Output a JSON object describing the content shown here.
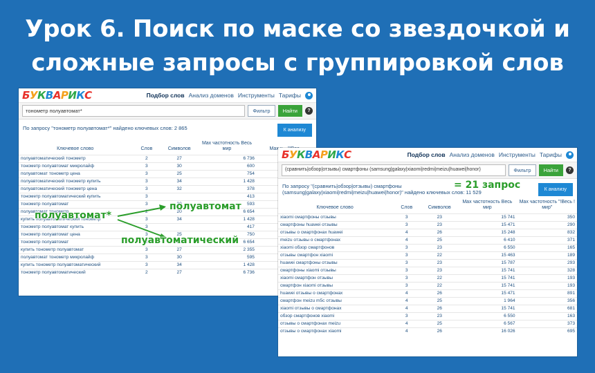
{
  "title_line1": "Урок 6. Поиск по маске со звездочкой и",
  "title_line2": "сложные запросы с группировкой слов",
  "logo": {
    "text": "БУКВАРИКС",
    "letters": [
      "Б",
      "У",
      "К",
      "В",
      "А",
      "Р",
      "И",
      "К",
      "С"
    ],
    "colors": [
      "#e8302a",
      "#f4a11d",
      "#2ea84a",
      "#1e88d4",
      "#e8302a",
      "#f4a11d",
      "#2ea84a",
      "#1e88d4",
      "#e8302a"
    ]
  },
  "nav": [
    "Подбор слов",
    "Анализ доменов",
    "Инструменты",
    "Тарифы"
  ],
  "filter_label": "Фильтр",
  "find_label": "Найти",
  "help_label": "?",
  "analyze_label": "К анализу",
  "screen1": {
    "query": "тонометр полуавтомат*",
    "result": "По запросу \"тонометр полуавтомат*\" найдено ключевых слов: 2 865",
    "headers": [
      "Ключевое слово",
      "Слов",
      "Символов",
      "Max частотность Весь мир",
      "Max ч... \"IBес..."
    ],
    "rows": [
      [
        "полуавтоматический тонометр",
        "2",
        "27",
        "6 736",
        ""
      ],
      [
        "тонометр полуавтомат микролайф",
        "3",
        "30",
        "600",
        ""
      ],
      [
        "полуавтомат тонометр цена",
        "3",
        "25",
        "754",
        ""
      ],
      [
        "полуавтоматический тонометр купить",
        "3",
        "34",
        "1 428",
        ""
      ],
      [
        "полуавтоматический тонометр цена",
        "3",
        "32",
        "378",
        ""
      ],
      [
        "тонометр полуавтоматический купить",
        "3",
        "",
        "413",
        ""
      ],
      [
        "тонометр полуавтомат",
        "3",
        "30",
        "593",
        ""
      ],
      [
        "полуавтомат тонометр",
        "2",
        "20",
        "6 654",
        ""
      ],
      [
        "купить полуавтоматический тонометр",
        "3",
        "34",
        "1 428",
        ""
      ],
      [
        "тонометр полуавтомат купить",
        "3",
        "",
        "417",
        ""
      ],
      [
        "тонометр полуавтомат цена",
        "3",
        "25",
        "750",
        ""
      ],
      [
        "тонометр полуавтомат",
        "2",
        "20",
        "6 654",
        ""
      ],
      [
        "купить тонометр полуавтомат",
        "3",
        "27",
        "2 355",
        ""
      ],
      [
        "полуавтомат тонометр микролайф",
        "3",
        "30",
        "595",
        ""
      ],
      [
        "купить тонометр полуавтоматический",
        "3",
        "34",
        "1 428",
        ""
      ],
      [
        "тонометр полуавтоматический",
        "2",
        "27",
        "6 736",
        ""
      ]
    ]
  },
  "screen2": {
    "query": "(сравнить|обзор|отзывы) смартфоны (samsung|galaxy|xiaomi|redmi|meizu|huawei|honor)",
    "result_line1": "По запросу \"(сравнить|обзор|отзывы) смартфоны",
    "result_line2": "(samsung|galaxy|xiaomi|redmi|meizu|huawei|honor)\" найдено ключевых слов: 11 529",
    "headers": [
      "Ключевое слово",
      "Слов",
      "Символов",
      "Max частотность Весь мир",
      "Max частотность \"!Весь !мир\""
    ],
    "rows": [
      [
        "xiaomi смартфоны отзывы",
        "3",
        "23",
        "15 741",
        "350"
      ],
      [
        "смартфоны huawei отзывы",
        "3",
        "23",
        "15 471",
        "290"
      ],
      [
        "отзывы о смартфонах huawei",
        "4",
        "26",
        "15 248",
        "832"
      ],
      [
        "meizu отзывы о смартфонах",
        "4",
        "25",
        "6 410",
        "371"
      ],
      [
        "xiaomi обзор смартфонов",
        "3",
        "23",
        "6 550",
        "165"
      ],
      [
        "отзывы смартфон xiaomi",
        "3",
        "22",
        "15 463",
        "189"
      ],
      [
        "huawei смартфоны отзывы",
        "3",
        "23",
        "15 787",
        "293"
      ],
      [
        "смартфоны xiaomi отзывы",
        "3",
        "23",
        "15 741",
        "328"
      ],
      [
        "xiaomi смартфон отзывы",
        "3",
        "22",
        "15 741",
        "193"
      ],
      [
        "смартфон xiaomi отзывы",
        "3",
        "22",
        "15 741",
        "193"
      ],
      [
        "huawei отзывы о смартфонах",
        "4",
        "26",
        "15 471",
        "891"
      ],
      [
        "смартфон meizu m5c отзывы",
        "4",
        "25",
        "1 964",
        "356"
      ],
      [
        "xiaomi отзывы о смартфонах",
        "4",
        "26",
        "15 741",
        "681"
      ],
      [
        "обзор смартфонов xiaomi",
        "3",
        "23",
        "6 550",
        "163"
      ],
      [
        "отзывы о смартфонах meizu",
        "4",
        "25",
        "6 567",
        "373"
      ],
      [
        "отзывы о смартфонах xiaomi",
        "4",
        "26",
        "16 026",
        "695"
      ]
    ]
  },
  "annotations": {
    "wildcard": "полуавтомат*",
    "variant1": "полуавтомат",
    "variant2": "полуавтоматический",
    "count": "= 21 запрос"
  }
}
